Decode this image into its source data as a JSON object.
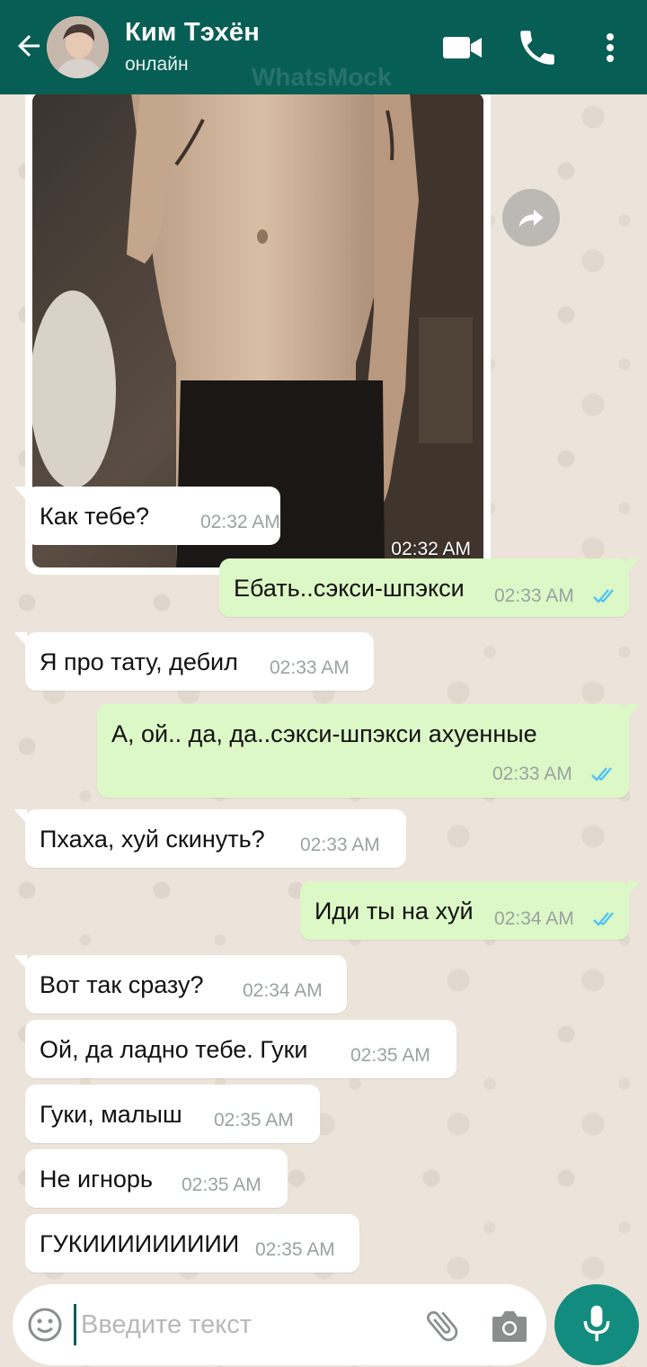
{
  "header": {
    "contact_name": "Ким Тэхён",
    "status": "онлайн",
    "watermark": "WhatsMock",
    "icons": [
      "back-arrow-icon",
      "video-call-icon",
      "phone-icon",
      "more-vert-icon"
    ]
  },
  "colors": {
    "header_bg": "#075e54",
    "incoming_bubble": "#ffffff",
    "outgoing_bubble": "#dcf8c6",
    "read_ticks": "#4fc3f7",
    "mic_button": "#128c7e"
  },
  "photo_message": {
    "time": "02:32 AM"
  },
  "messages": [
    {
      "dir": "in",
      "text": "Как тебе?",
      "time": "02:32 AM"
    },
    {
      "dir": "out",
      "text": "Ебать..сэкси-шпэкси",
      "time": "02:33 AM",
      "read": true
    },
    {
      "dir": "in",
      "text": "Я про тату, дебил",
      "time": "02:33 AM"
    },
    {
      "dir": "out",
      "text": "А, ой.. да, да..сэкси-шпэкси ахуенные",
      "time": "02:33 AM",
      "read": true
    },
    {
      "dir": "in",
      "text": "Пхаха, хуй скинуть?",
      "time": "02:33 AM"
    },
    {
      "dir": "out",
      "text": "Иди ты на хуй",
      "time": "02:34 AM",
      "read": true
    },
    {
      "dir": "in",
      "text": "Вот так сразу?",
      "time": "02:34 AM"
    },
    {
      "dir": "in",
      "text": "Ой, да ладно тебе. Гуки",
      "time": "02:35 AM"
    },
    {
      "dir": "in",
      "text": "Гуки, малыш",
      "time": "02:35 AM"
    },
    {
      "dir": "in",
      "text": "Не игнорь",
      "time": "02:35 AM"
    },
    {
      "dir": "in",
      "text": "ГУКИИИИИИИИИ",
      "time": "02:35 AM"
    }
  ],
  "input": {
    "placeholder": "Введите текст",
    "value": ""
  }
}
